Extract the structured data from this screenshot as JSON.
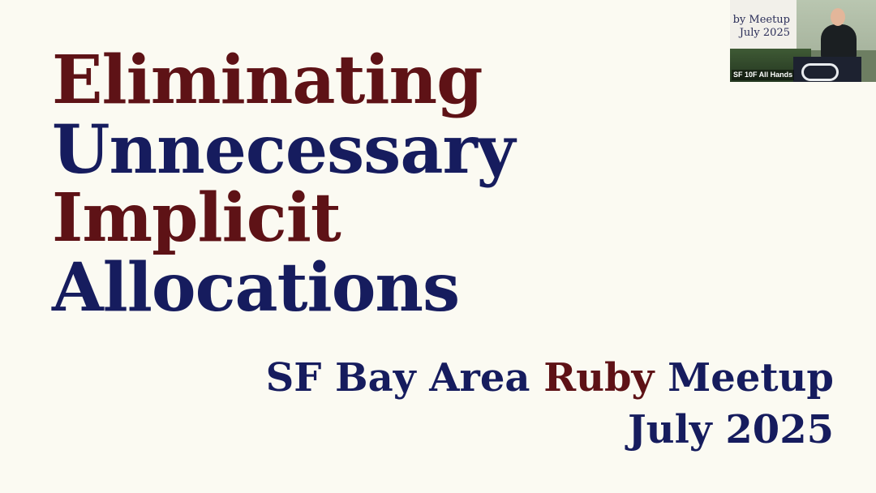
{
  "slide": {
    "title_lines": [
      "Eliminating",
      "Unnecessary",
      "Implicit",
      "Allocations"
    ],
    "subtitle": {
      "part1": "SF Bay Area ",
      "part2": "Ruby",
      "part3": " Meetup",
      "line2": "July 2025"
    }
  },
  "video_thumbnail": {
    "screen_line1": "by Meetup",
    "screen_line2": "July 2025",
    "label": "SF 10F All Hands"
  },
  "colors": {
    "background": "#fbfaf2",
    "maroon": "#5e1216",
    "navy": "#161c5e"
  }
}
